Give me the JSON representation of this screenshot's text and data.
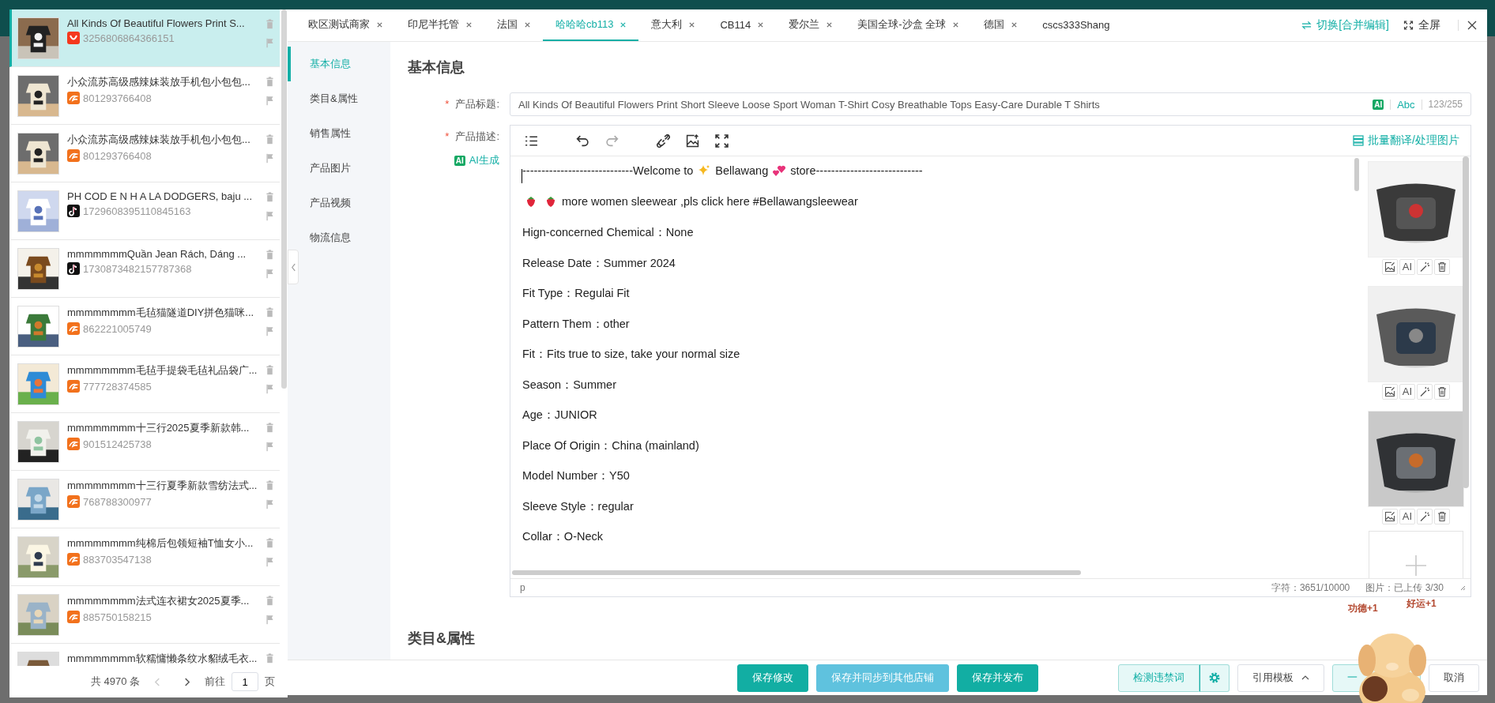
{
  "drawer": {
    "items": [
      {
        "title": "All Kinds Of Beautiful Flowers Print S...",
        "id": "3256806864366151",
        "kind": "bag",
        "selected": true
      },
      {
        "title": "小众流苏高级感辣妹装放手机包小包包...",
        "id": "801293766408",
        "kind": "swirl",
        "selected": false
      },
      {
        "title": "小众流苏高级感辣妹装放手机包小包包...",
        "id": "801293766408",
        "kind": "swirl",
        "selected": false
      },
      {
        "title": "PH COD E N H A LA DODGERS, baju ...",
        "id": "1729608395110845163",
        "kind": "note",
        "selected": false
      },
      {
        "title": "mmmmmmmQuần Jean Rách, Dáng ...",
        "id": "1730873482157787368",
        "kind": "note",
        "selected": false
      },
      {
        "title": "mmmmmmmm毛毡猫隧道DIY拼色猫咪...",
        "id": "862221005749",
        "kind": "swirl",
        "selected": false
      },
      {
        "title": "mmmmmmmm毛毡手提袋毛毡礼品袋广...",
        "id": "777728374585",
        "kind": "swirl",
        "selected": false
      },
      {
        "title": "mmmmmmmm十三行2025夏季新款韩...",
        "id": "901512425738",
        "kind": "swirl",
        "selected": false
      },
      {
        "title": "mmmmmmmm十三行夏季新款雪纺法式...",
        "id": "768788300977",
        "kind": "swirl",
        "selected": false
      },
      {
        "title": "mmmmmmmm纯棉后包领短袖T恤女小...",
        "id": "883703547138",
        "kind": "swirl",
        "selected": false
      },
      {
        "title": "mmmmmmmm法式连衣裙女2025夏季...",
        "id": "885750158215",
        "kind": "swirl",
        "selected": false
      },
      {
        "title": "mmmmmmmm软糯慵懒条纹水貂绒毛衣...",
        "selected": false
      }
    ],
    "pagination": {
      "total": "共 4970 条",
      "prev": {
        "disabled": true
      },
      "next": {
        "disabled": false
      },
      "goto": "前往",
      "page": "1",
      "suffix": "页"
    }
  },
  "modal": {
    "tabs": [
      {
        "label": "欧区测试商家",
        "selected": false,
        "closable": true
      },
      {
        "label": "印尼半托管",
        "selected": false,
        "closable": true
      },
      {
        "label": "法国",
        "selected": false,
        "closable": true
      },
      {
        "label": "哈哈哈cb113",
        "selected": true,
        "closable": true
      },
      {
        "label": "意大利",
        "selected": false,
        "closable": true
      },
      {
        "label": "CB114",
        "selected": false,
        "closable": true
      },
      {
        "label": "爱尔兰",
        "selected": false,
        "closable": true
      },
      {
        "label": "美国全球-沙盒 全球",
        "selected": false,
        "closable": true
      },
      {
        "label": "德国",
        "selected": false,
        "closable": true
      },
      {
        "label": "cscs333Shang",
        "selected": false,
        "closable": false
      }
    ],
    "switch_button": "切换[合并编辑]",
    "fullscreen_button": "全屏",
    "nav": [
      {
        "label": "基本信息",
        "selected": true
      },
      {
        "label": "类目&属性",
        "selected": false
      },
      {
        "label": "销售属性",
        "selected": false
      },
      {
        "label": "产品图片",
        "selected": false
      },
      {
        "label": "产品视频",
        "selected": false
      },
      {
        "label": "物流信息",
        "selected": false
      }
    ],
    "section_title": "基本信息",
    "title_field": {
      "label": "产品标题:",
      "required_mark": "*",
      "value": "All Kinds Of Beautiful Flowers Print Short Sleeve Loose Sport Woman T-Shirt Cosy Breathable Tops Easy-Care Durable T Shirts",
      "ai_badge": "AI",
      "abc": "Abc",
      "counter": "123/255"
    },
    "description": {
      "label": "产品描述:",
      "required_mark": "*",
      "ai_button": {
        "badge": "AI",
        "label": "AI生成"
      },
      "batch_button": "批量翻译/处理图片",
      "lines": [
        {
          "kind": "welcome",
          "parts": [
            "-----------------------------Welcome to ",
            "Bellawang",
            "store----------------------------"
          ]
        },
        {
          "kind": "promo",
          "text": "more women sleewear ,pls click here #Bellawangsleewear"
        },
        {
          "kind": "plain",
          "text": "Hign-concerned Chemical：None"
        },
        {
          "kind": "plain",
          "text": "Release Date：Summer 2024"
        },
        {
          "kind": "plain",
          "text": "Fit Type：Regulai Fit"
        },
        {
          "kind": "plain",
          "text": "Pattern Them：other"
        },
        {
          "kind": "plain",
          "text": "Fit：Fits true to size, take your normal size"
        },
        {
          "kind": "plain",
          "text": "Season：Summer"
        },
        {
          "kind": "plain",
          "text": "Age：JUNIOR"
        },
        {
          "kind": "plain",
          "text": "Place Of Origin：China (mainland)"
        },
        {
          "kind": "plain",
          "text": "Model Number：Y50"
        },
        {
          "kind": "plain",
          "text": "Sleeve Style：regular"
        },
        {
          "kind": "plain",
          "text": "Collar：O-Neck"
        }
      ],
      "images": [
        {
          "ai_label": "AI"
        },
        {
          "ai_label": "AI"
        },
        {
          "ai_label": "AI"
        }
      ],
      "status": {
        "tag": "p",
        "chars": "字符：3651/10000",
        "images": "图片：已上传 3/30"
      }
    },
    "section2_title": "类目&属性",
    "footer": {
      "left": [
        {
          "label": "保存修改",
          "kind": "primary"
        },
        {
          "label": "保存并同步到其他店铺",
          "kind": "light"
        },
        {
          "label": "保存并发布",
          "kind": "primary"
        }
      ],
      "right": [
        {
          "label": "检测违禁词",
          "kind": "check"
        },
        {
          "label": "引用模板",
          "kind": "menu"
        },
        {
          "label": "一",
          "kind": "outline"
        },
        {
          "label": "取消",
          "kind": "plain"
        }
      ]
    }
  },
  "sticker": {
    "texts": [
      "功德+1",
      "好运+1"
    ]
  }
}
